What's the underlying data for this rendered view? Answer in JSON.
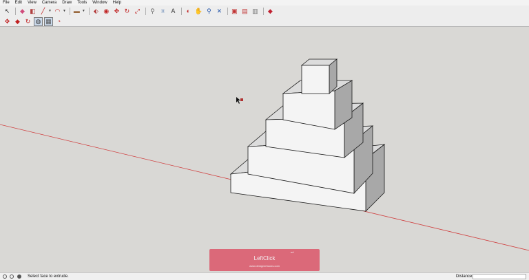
{
  "menu": [
    "File",
    "Edit",
    "View",
    "Camera",
    "Draw",
    "Tools",
    "Window",
    "Help"
  ],
  "toolbar1": [
    {
      "name": "select-tool-icon",
      "glyph": "↖",
      "color": "#222"
    },
    {
      "type": "sep"
    },
    {
      "name": "eraser-tool-icon",
      "glyph": "◆",
      "color": "#d04a7a"
    },
    {
      "name": "paint-bucket-tool-icon",
      "glyph": "◧",
      "color": "#b04040"
    },
    {
      "name": "line-tool-icon",
      "glyph": "╱",
      "color": "#c02020",
      "caret": true
    },
    {
      "name": "arc-tool-icon",
      "glyph": "◠",
      "color": "#c02020",
      "caret": true
    },
    {
      "type": "sep"
    },
    {
      "name": "rectangle-tool-icon",
      "glyph": "▬",
      "color": "#9a6a40",
      "caret": true
    },
    {
      "type": "sep"
    },
    {
      "name": "push-pull-tool-icon",
      "glyph": "⬖",
      "color": "#b03030"
    },
    {
      "name": "offset-tool-icon",
      "glyph": "◉",
      "color": "#c02020"
    },
    {
      "name": "move-tool-icon",
      "glyph": "✥",
      "color": "#c02020"
    },
    {
      "name": "rotate-tool-icon",
      "glyph": "↻",
      "color": "#c02020"
    },
    {
      "name": "scale-tool-icon",
      "glyph": "⤢",
      "color": "#c02020"
    },
    {
      "type": "sep"
    },
    {
      "name": "tape-measure-tool-icon",
      "glyph": "⚲",
      "color": "#666"
    },
    {
      "name": "dimension-tool-icon",
      "glyph": "⌗",
      "color": "#3060a0"
    },
    {
      "name": "text-tool-icon",
      "glyph": "A",
      "color": "#333"
    },
    {
      "type": "sep"
    },
    {
      "name": "orbit-tool-icon",
      "glyph": "◐",
      "color": "#c02020"
    },
    {
      "name": "pan-tool-icon",
      "glyph": "✋",
      "color": "#bb6622"
    },
    {
      "name": "zoom-tool-icon",
      "glyph": "⚲",
      "color": "#2255aa"
    },
    {
      "name": "zoom-extents-tool-icon",
      "glyph": "✕",
      "color": "#2255aa"
    },
    {
      "type": "sep"
    },
    {
      "name": "warehouse-icon",
      "glyph": "▣",
      "color": "#c03030"
    },
    {
      "name": "extension-warehouse-icon",
      "glyph": "▤",
      "color": "#c03030"
    },
    {
      "name": "share-model-icon",
      "glyph": "▥",
      "color": "#777"
    },
    {
      "type": "sep"
    },
    {
      "name": "ruby-console-icon",
      "glyph": "◆",
      "color": "#c02030"
    }
  ],
  "toolbar2": [
    {
      "name": "camera-move-icon",
      "glyph": "✥",
      "color": "#c02020"
    },
    {
      "name": "camera-orbit-icon",
      "glyph": "◆",
      "color": "#c02020"
    },
    {
      "name": "camera-rotate-icon",
      "glyph": "↻",
      "color": "#c02020"
    },
    {
      "name": "camera-walk-icon",
      "glyph": "◍",
      "color": "#333",
      "active": true
    },
    {
      "name": "camera-position-icon",
      "glyph": "▦",
      "color": "#555",
      "active": true
    },
    {
      "name": "camera-look-icon",
      "glyph": "◔",
      "color": "#c02020"
    }
  ],
  "status": {
    "text": "Select face to extrude.",
    "measure_label": "Distance",
    "measure_value": ""
  },
  "overlay": {
    "label": "LeftClick",
    "site": "www.designerhacks.com",
    "mark": "ed"
  },
  "colors": {
    "viewport": "#d9d8d5",
    "axis_red": "#d04040",
    "face_front": "#f4f4f4",
    "face_top": "#dcdcdc",
    "face_side": "#a8a8a8",
    "edge": "#1a1a1a"
  }
}
